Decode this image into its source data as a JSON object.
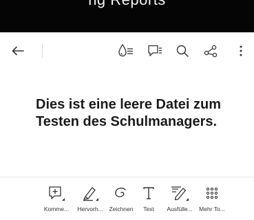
{
  "status_bar": {
    "cut_text": "ng Reports"
  },
  "toolbar": {
    "back_icon": "arrow-left-icon",
    "icons": [
      "liquid-mode-icon",
      "comment-list-icon",
      "search-icon",
      "share-icon",
      "more-vertical-icon"
    ]
  },
  "document": {
    "line1": "Dies ist eine leere Datei zum",
    "line2": "Testen des Schulmanagers."
  },
  "bottom_tools": [
    {
      "label": "Komme...",
      "icon": "add-comment-icon"
    },
    {
      "label": "Hervorh...",
      "icon": "highlighter-icon"
    },
    {
      "label": "Zeichnen",
      "icon": "draw-icon"
    },
    {
      "label": "Text",
      "icon": "text-icon"
    },
    {
      "label": "Ausfülle...",
      "icon": "fill-sign-icon"
    },
    {
      "label": "Mehr To...",
      "icon": "more-tools-icon"
    }
  ]
}
